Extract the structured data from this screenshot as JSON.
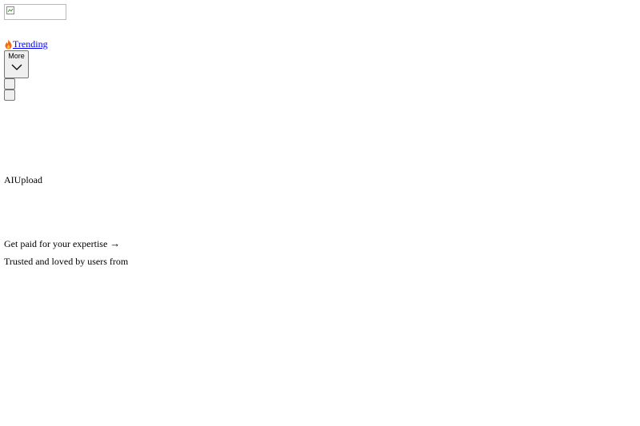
{
  "header": {
    "trending_label": "Trending",
    "more_label": "More"
  },
  "hero": {
    "ai_label": "AI",
    "upload_label": "Upload",
    "cta_text": "Get paid for your expertise",
    "cta_arrow": "→",
    "trusted_text": "Trusted and loved by users from"
  },
  "icons": {
    "logo": "broken-image-icon",
    "trending": "fire-icon",
    "more": "chevron-down-icon",
    "cta": "arrow-right-icon"
  },
  "colors": {
    "link": "#0000ee",
    "fire": "#f06a1e"
  }
}
